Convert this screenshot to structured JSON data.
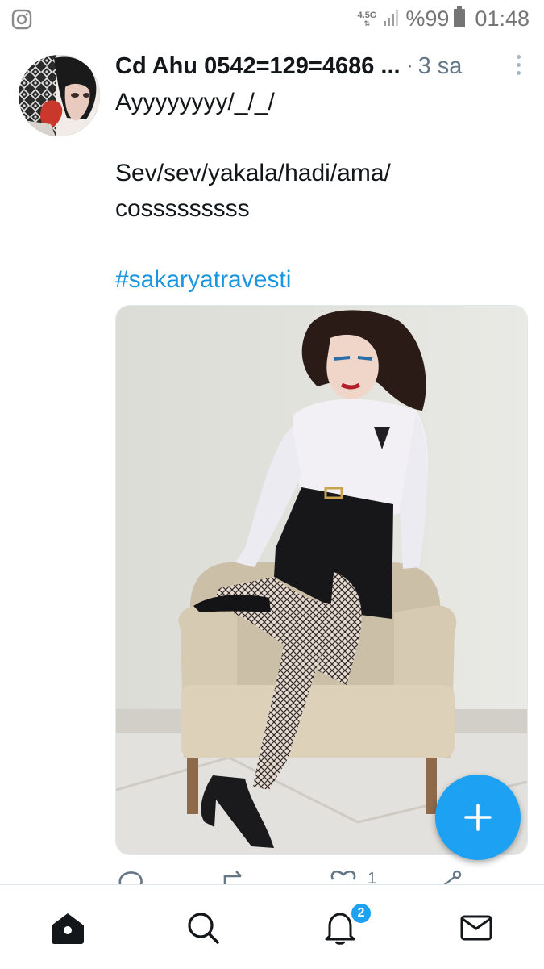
{
  "status_bar": {
    "network_label": "4.5G",
    "battery_text": "%99",
    "time": "01:48",
    "left_icon": "instagram-icon"
  },
  "tweet": {
    "author": "Cd Ahu 0542=129=4686 ...",
    "dot": "·",
    "time_ago": "3 sa",
    "line1": "Ayyyyyyyy/_/_/",
    "line2": "Sev/sev/yakala/hadi/ama/",
    "line3": "cosssssssss",
    "hashtag": "#sakaryatravesti",
    "like_count": "1"
  },
  "icons": {
    "reply": "reply-icon",
    "retweet": "retweet-icon",
    "like": "heart-icon",
    "share": "share-icon",
    "compose": "plus-icon"
  },
  "bottom_nav": {
    "items": [
      "home-icon",
      "search-icon",
      "notifications-icon",
      "messages-icon"
    ],
    "notification_badge": "2"
  },
  "colors": {
    "accent": "#1da1f2",
    "hashtag": "#1b95e0",
    "secondary_text": "#657786"
  }
}
